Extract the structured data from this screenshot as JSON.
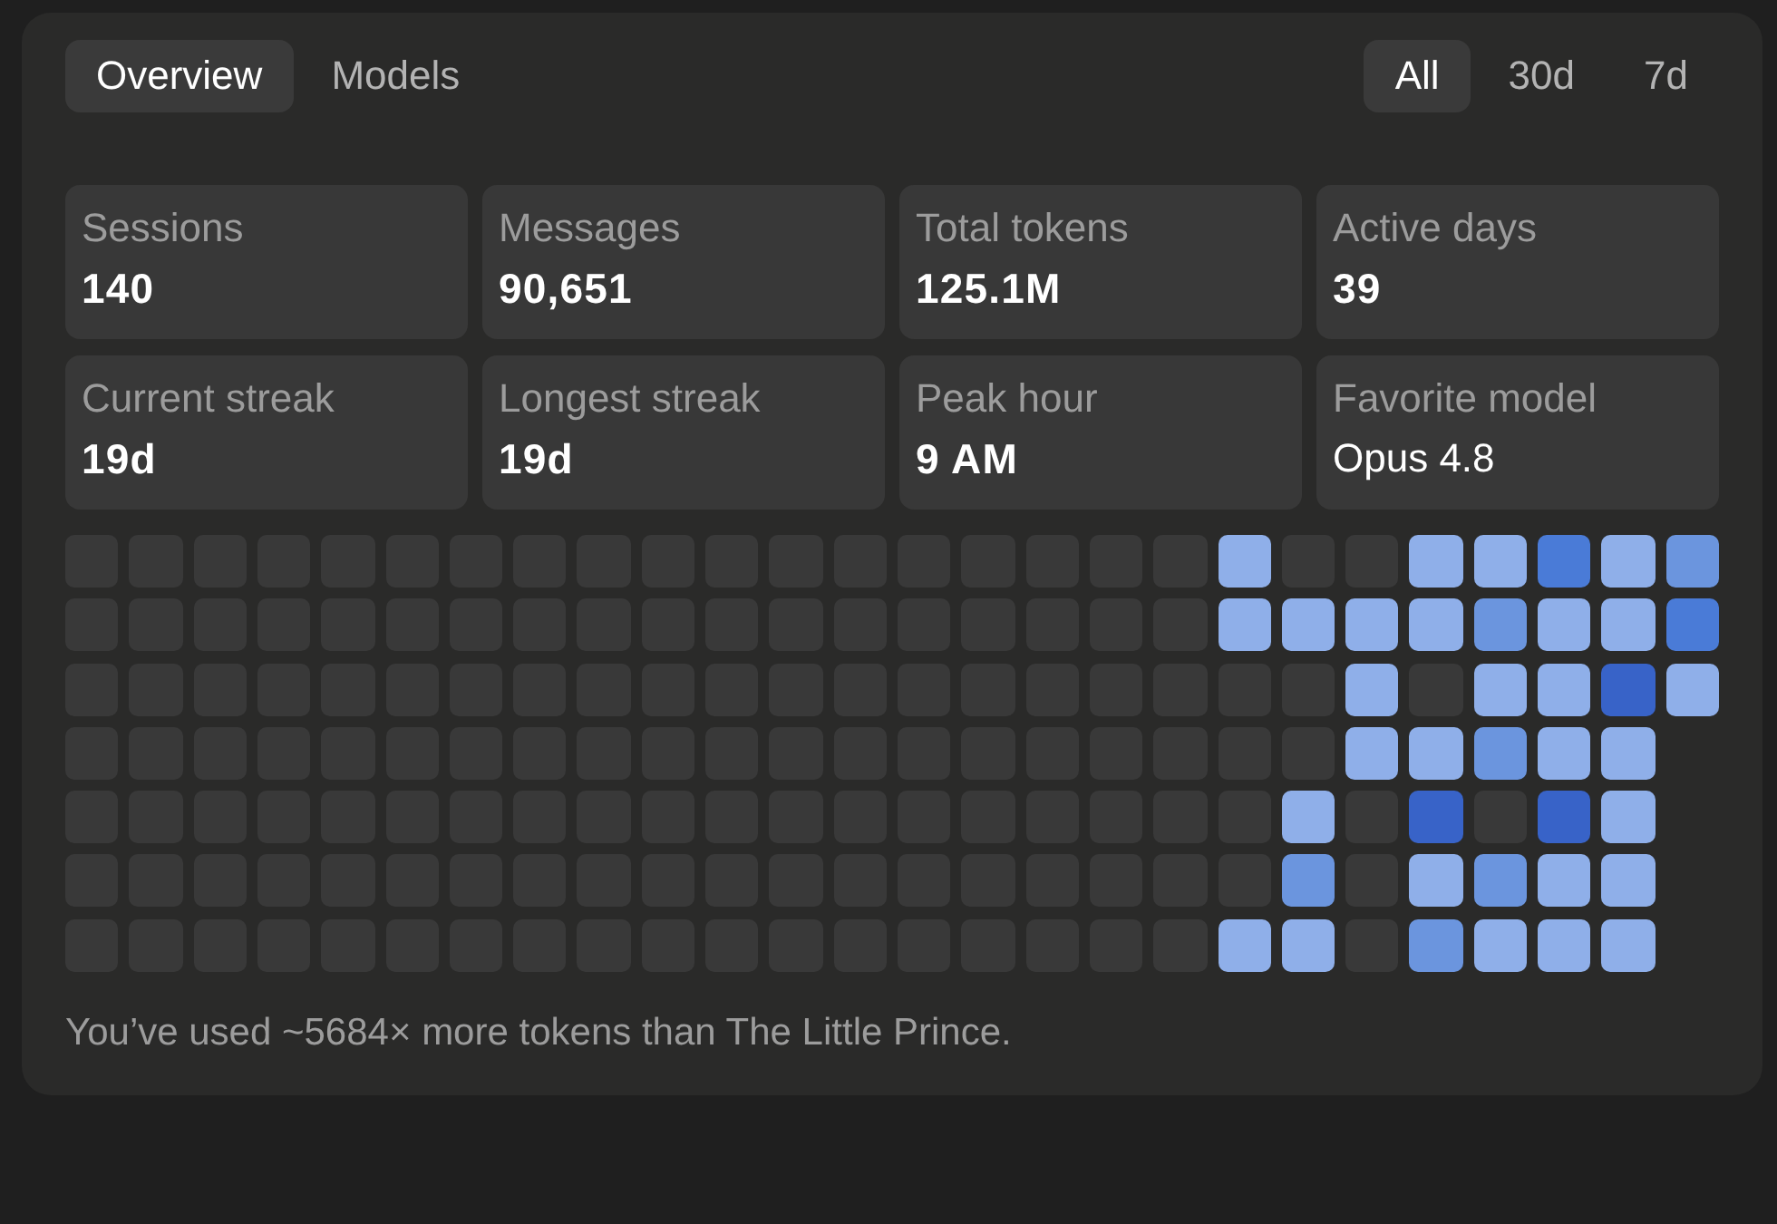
{
  "tabs": [
    {
      "label": "Overview",
      "selected": true
    },
    {
      "label": "Models",
      "selected": false
    }
  ],
  "ranges": [
    {
      "label": "All",
      "selected": true
    },
    {
      "label": "30d",
      "selected": false
    },
    {
      "label": "7d",
      "selected": false
    }
  ],
  "stats": [
    {
      "label": "Sessions",
      "value": "140",
      "kind": "number"
    },
    {
      "label": "Messages",
      "value": "90,651",
      "kind": "number"
    },
    {
      "label": "Total tokens",
      "value": "125.1M",
      "kind": "number"
    },
    {
      "label": "Active days",
      "value": "39",
      "kind": "number"
    },
    {
      "label": "Current streak",
      "value": "19d",
      "kind": "number"
    },
    {
      "label": "Longest streak",
      "value": "19d",
      "kind": "number"
    },
    {
      "label": "Peak hour",
      "value": "9 AM",
      "kind": "number"
    },
    {
      "label": "Favorite model",
      "value": "Opus 4.8",
      "kind": "name"
    }
  ],
  "heatmap": {
    "weeks": [
      {
        "days": [
          {
            "color": "#393939"
          },
          {
            "color": "#393939"
          },
          {
            "color": "#393939"
          },
          {
            "color": "#393939"
          },
          {
            "color": "#393939"
          },
          {
            "color": "#393939"
          },
          {
            "color": "#393939"
          }
        ]
      },
      {
        "days": [
          {
            "color": "#393939"
          },
          {
            "color": "#393939"
          },
          {
            "color": "#393939"
          },
          {
            "color": "#393939"
          },
          {
            "color": "#393939"
          },
          {
            "color": "#393939"
          },
          {
            "color": "#393939"
          }
        ]
      },
      {
        "days": [
          {
            "color": "#393939"
          },
          {
            "color": "#393939"
          },
          {
            "color": "#393939"
          },
          {
            "color": "#393939"
          },
          {
            "color": "#393939"
          },
          {
            "color": "#393939"
          },
          {
            "color": "#393939"
          }
        ]
      },
      {
        "days": [
          {
            "color": "#393939"
          },
          {
            "color": "#393939"
          },
          {
            "color": "#393939"
          },
          {
            "color": "#393939"
          },
          {
            "color": "#393939"
          },
          {
            "color": "#393939"
          },
          {
            "color": "#393939"
          }
        ]
      },
      {
        "days": [
          {
            "color": "#393939"
          },
          {
            "color": "#393939"
          },
          {
            "color": "#393939"
          },
          {
            "color": "#393939"
          },
          {
            "color": "#393939"
          },
          {
            "color": "#393939"
          },
          {
            "color": "#393939"
          }
        ]
      },
      {
        "days": [
          {
            "color": "#393939"
          },
          {
            "color": "#393939"
          },
          {
            "color": "#393939"
          },
          {
            "color": "#393939"
          },
          {
            "color": "#393939"
          },
          {
            "color": "#393939"
          },
          {
            "color": "#393939"
          }
        ]
      },
      {
        "days": [
          {
            "color": "#393939"
          },
          {
            "color": "#393939"
          },
          {
            "color": "#393939"
          },
          {
            "color": "#393939"
          },
          {
            "color": "#393939"
          },
          {
            "color": "#393939"
          },
          {
            "color": "#393939"
          }
        ]
      },
      {
        "days": [
          {
            "color": "#393939"
          },
          {
            "color": "#393939"
          },
          {
            "color": "#393939"
          },
          {
            "color": "#393939"
          },
          {
            "color": "#393939"
          },
          {
            "color": "#393939"
          },
          {
            "color": "#393939"
          }
        ]
      },
      {
        "days": [
          {
            "color": "#393939"
          },
          {
            "color": "#393939"
          },
          {
            "color": "#393939"
          },
          {
            "color": "#393939"
          },
          {
            "color": "#393939"
          },
          {
            "color": "#393939"
          },
          {
            "color": "#393939"
          }
        ]
      },
      {
        "days": [
          {
            "color": "#393939"
          },
          {
            "color": "#393939"
          },
          {
            "color": "#393939"
          },
          {
            "color": "#393939"
          },
          {
            "color": "#393939"
          },
          {
            "color": "#393939"
          },
          {
            "color": "#393939"
          }
        ]
      },
      {
        "days": [
          {
            "color": "#393939"
          },
          {
            "color": "#393939"
          },
          {
            "color": "#393939"
          },
          {
            "color": "#393939"
          },
          {
            "color": "#393939"
          },
          {
            "color": "#393939"
          },
          {
            "color": "#393939"
          }
        ]
      },
      {
        "days": [
          {
            "color": "#393939"
          },
          {
            "color": "#393939"
          },
          {
            "color": "#393939"
          },
          {
            "color": "#393939"
          },
          {
            "color": "#393939"
          },
          {
            "color": "#393939"
          },
          {
            "color": "#393939"
          }
        ]
      },
      {
        "days": [
          {
            "color": "#393939"
          },
          {
            "color": "#393939"
          },
          {
            "color": "#393939"
          },
          {
            "color": "#393939"
          },
          {
            "color": "#393939"
          },
          {
            "color": "#393939"
          },
          {
            "color": "#393939"
          }
        ]
      },
      {
        "days": [
          {
            "color": "#393939"
          },
          {
            "color": "#393939"
          },
          {
            "color": "#393939"
          },
          {
            "color": "#393939"
          },
          {
            "color": "#393939"
          },
          {
            "color": "#393939"
          },
          {
            "color": "#393939"
          }
        ]
      },
      {
        "days": [
          {
            "color": "#393939"
          },
          {
            "color": "#393939"
          },
          {
            "color": "#393939"
          },
          {
            "color": "#393939"
          },
          {
            "color": "#393939"
          },
          {
            "color": "#393939"
          },
          {
            "color": "#393939"
          }
        ]
      },
      {
        "days": [
          {
            "color": "#393939"
          },
          {
            "color": "#393939"
          },
          {
            "color": "#393939"
          },
          {
            "color": "#393939"
          },
          {
            "color": "#393939"
          },
          {
            "color": "#393939"
          },
          {
            "color": "#393939"
          }
        ]
      },
      {
        "days": [
          {
            "color": "#393939"
          },
          {
            "color": "#393939"
          },
          {
            "color": "#393939"
          },
          {
            "color": "#393939"
          },
          {
            "color": "#393939"
          },
          {
            "color": "#393939"
          },
          {
            "color": "#393939"
          }
        ]
      },
      {
        "days": [
          {
            "color": "#393939"
          },
          {
            "color": "#393939"
          },
          {
            "color": "#393939"
          },
          {
            "color": "#393939"
          },
          {
            "color": "#393939"
          },
          {
            "color": "#393939"
          },
          {
            "color": "#393939"
          }
        ]
      },
      {
        "days": [
          {
            "color": "#8fafe9"
          },
          {
            "color": "#8fafe9"
          },
          {
            "color": "#393939"
          },
          {
            "color": "#393939"
          },
          {
            "color": "#393939"
          },
          {
            "color": "#393939"
          },
          {
            "color": "#8fafe9"
          }
        ]
      },
      {
        "days": [
          {
            "color": "#393939"
          },
          {
            "color": "#8fafe9"
          },
          {
            "color": "#393939"
          },
          {
            "color": "#393939"
          },
          {
            "color": "#8fafe9"
          },
          {
            "color": "#6b95de"
          },
          {
            "color": "#8fafe9"
          }
        ]
      },
      {
        "days": [
          {
            "color": "#393939"
          },
          {
            "color": "#8fafe9"
          },
          {
            "color": "#8fafe9"
          },
          {
            "color": "#8fafe9"
          },
          {
            "color": "#393939"
          },
          {
            "color": "#393939"
          },
          {
            "color": "#393939"
          }
        ]
      },
      {
        "days": [
          {
            "color": "#8fafe9"
          },
          {
            "color": "#8fafe9"
          },
          {
            "color": "#393939"
          },
          {
            "color": "#8fafe9"
          },
          {
            "color": "#3863c8"
          },
          {
            "color": "#8fafe9"
          },
          {
            "color": "#6b95de"
          }
        ]
      },
      {
        "days": [
          {
            "color": "#8fafe9"
          },
          {
            "color": "#6b95de"
          },
          {
            "color": "#8fafe9"
          },
          {
            "color": "#6b95de"
          },
          {
            "color": "#393939"
          },
          {
            "color": "#6b95de"
          },
          {
            "color": "#8fafe9"
          }
        ]
      },
      {
        "days": [
          {
            "color": "#4a7bd7"
          },
          {
            "color": "#8fafe9"
          },
          {
            "color": "#8fafe9"
          },
          {
            "color": "#8fafe9"
          },
          {
            "color": "#3863c8"
          },
          {
            "color": "#8fafe9"
          },
          {
            "color": "#8fafe9"
          }
        ]
      },
      {
        "days": [
          {
            "color": "#8fafe9"
          },
          {
            "color": "#8fafe9"
          },
          {
            "color": "#3863c8"
          },
          {
            "color": "#8fafe9"
          },
          {
            "color": "#8fafe9"
          },
          {
            "color": "#8fafe9"
          },
          {
            "color": "#8fafe9"
          }
        ]
      },
      {
        "days": [
          {
            "color": "#6b95de"
          },
          {
            "color": "#4a7bd7"
          },
          {
            "color": "#8fafe9"
          }
        ]
      }
    ]
  },
  "summary": "You’ve used ~5684× more tokens than The Little Prince."
}
